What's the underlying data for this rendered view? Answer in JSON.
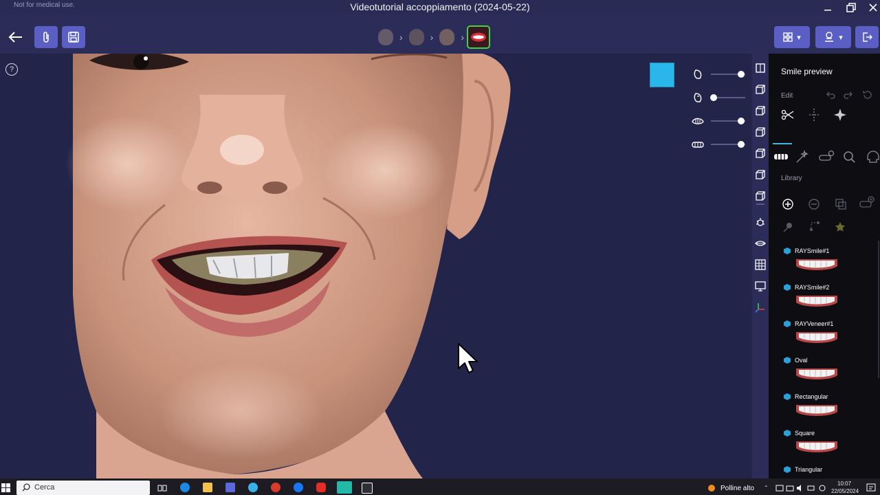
{
  "window": {
    "note": "Not for medical use.",
    "title": "Videotutorial accoppiamento (2024-05-22)"
  },
  "toolbar": {
    "back_icon": "arrow-left-icon",
    "attach_icon": "paperclip-icon",
    "save_icon": "save-icon",
    "steps": [
      "face-step-1",
      "face-step-2",
      "face-step-3",
      "smile-step"
    ],
    "active_step": "smile-step",
    "right_buttons": [
      "layout-grid-icon",
      "model-dropdown-icon",
      "export-icon"
    ]
  },
  "viewport": {
    "color_swatch": "#29b6ea",
    "sliders": [
      {
        "icon": "face-profile-icon",
        "level": 1.0
      },
      {
        "icon": "face-profile-alt-icon",
        "level": 0.0
      },
      {
        "icon": "jaw-upper-icon",
        "level": 1.0
      },
      {
        "icon": "teeth-row-icon",
        "level": 1.0
      }
    ]
  },
  "panel": {
    "title": "Smile preview",
    "edit_label": "Edit",
    "library_label": "Library",
    "library": [
      {
        "name": "RAYSmile#1"
      },
      {
        "name": "RAYSmile#2"
      },
      {
        "name": "RAYVeneer#1"
      },
      {
        "name": "Oval"
      },
      {
        "name": "Rectangular"
      },
      {
        "name": "Square"
      },
      {
        "name": "Triangular"
      }
    ]
  },
  "taskbar": {
    "search_placeholder": "Cerca",
    "weather": "Polline alto",
    "time": "10:07",
    "date": "22/05/2024"
  }
}
